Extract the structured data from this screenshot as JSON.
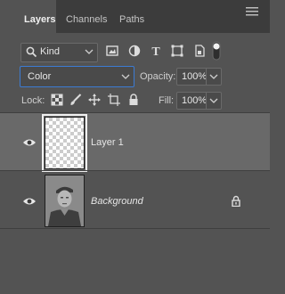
{
  "tabs": [
    "Layers",
    "Channels",
    "Paths"
  ],
  "active_tab": "Layers",
  "filter": {
    "label": "Kind"
  },
  "blend_mode": "Color",
  "opacity": {
    "label": "Opacity:",
    "value": "100%"
  },
  "lock": {
    "label": "Lock:"
  },
  "fill": {
    "label": "Fill:",
    "value": "100%"
  },
  "layers": [
    {
      "name": "Layer 1",
      "selected": true,
      "visible": true,
      "thumbnail": "transparent-checkerboard"
    },
    {
      "name": "Background",
      "selected": false,
      "visible": true,
      "locked": true,
      "thumbnail": "soldier-portrait"
    }
  ],
  "colors": {
    "panel": "#535353",
    "tabbar": "#3c3c3c",
    "selected_row": "#696969",
    "focus_border": "#3c7bd3"
  }
}
